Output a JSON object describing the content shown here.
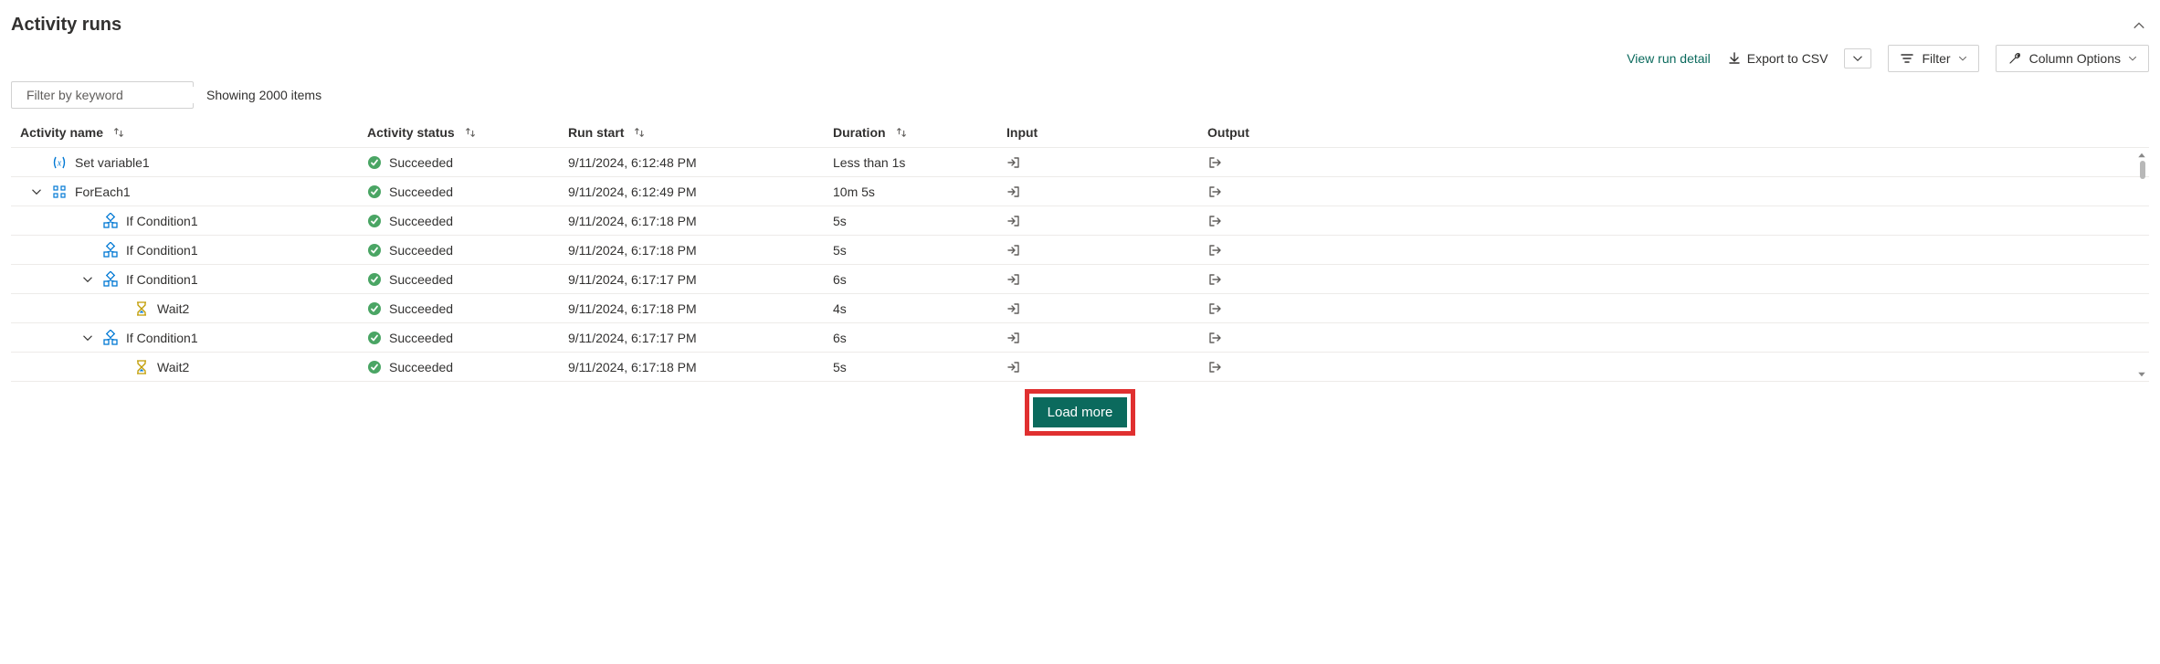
{
  "title": "Activity runs",
  "toolbar": {
    "view_run_detail": "View run detail",
    "export_csv": "Export to CSV",
    "filter": "Filter",
    "column_options": "Column Options"
  },
  "filter": {
    "placeholder": "Filter by keyword",
    "count_text": "Showing 2000 items"
  },
  "columns": {
    "activity_name": "Activity name",
    "activity_status": "Activity status",
    "run_start": "Run start",
    "duration": "Duration",
    "input": "Input",
    "output": "Output"
  },
  "status_label": "Succeeded",
  "rows": [
    {
      "name": "Set variable1",
      "icon": "variable",
      "indent": 0,
      "expander": "none",
      "start": "9/11/2024, 6:12:48 PM",
      "duration": "Less than 1s"
    },
    {
      "name": "ForEach1",
      "icon": "foreach",
      "indent": 0,
      "expander": "down",
      "start": "9/11/2024, 6:12:49 PM",
      "duration": "10m 5s"
    },
    {
      "name": "If Condition1",
      "icon": "if",
      "indent": 1,
      "expander": "none",
      "start": "9/11/2024, 6:17:18 PM",
      "duration": "5s"
    },
    {
      "name": "If Condition1",
      "icon": "if",
      "indent": 1,
      "expander": "none",
      "start": "9/11/2024, 6:17:18 PM",
      "duration": "5s"
    },
    {
      "name": "If Condition1",
      "icon": "if",
      "indent": 1,
      "expander": "down",
      "start": "9/11/2024, 6:17:17 PM",
      "duration": "6s"
    },
    {
      "name": "Wait2",
      "icon": "wait",
      "indent": 2,
      "expander": "none",
      "start": "9/11/2024, 6:17:18 PM",
      "duration": "4s"
    },
    {
      "name": "If Condition1",
      "icon": "if",
      "indent": 1,
      "expander": "down",
      "start": "9/11/2024, 6:17:17 PM",
      "duration": "6s"
    },
    {
      "name": "Wait2",
      "icon": "wait",
      "indent": 2,
      "expander": "none",
      "start": "9/11/2024, 6:17:18 PM",
      "duration": "5s"
    }
  ],
  "load_more": "Load more"
}
